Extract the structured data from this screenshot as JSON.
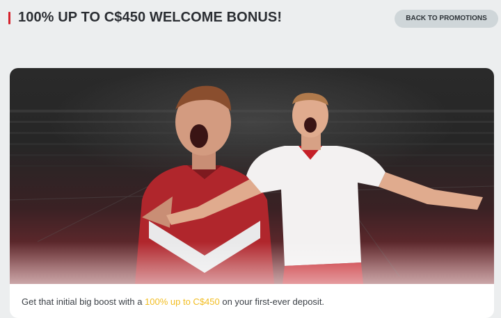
{
  "header": {
    "title": "100% UP TO C$450 WELCOME BONUS!",
    "back_label": "BACK TO PROMOTIONS"
  },
  "promo": {
    "description_before": "Get that initial big boost with a ",
    "description_highlight": "100% up to C$450",
    "description_after": " on your first-ever deposit."
  },
  "colors": {
    "accent": "#d5222c",
    "highlight": "#f2bd21",
    "button_bg": "#cfd6d9",
    "page_bg": "#eceeef"
  }
}
